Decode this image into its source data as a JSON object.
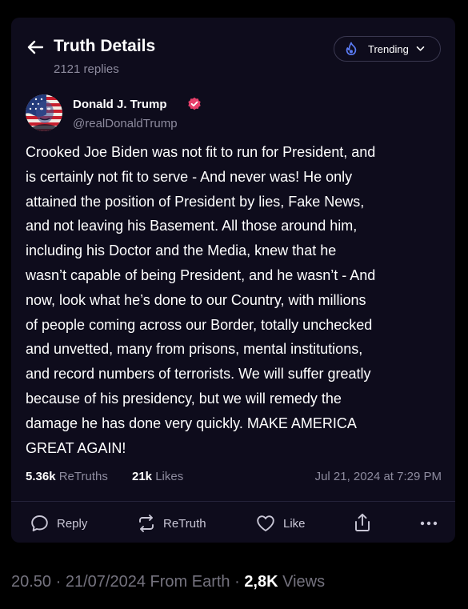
{
  "header": {
    "title": "Truth Details",
    "replies": "2121 replies",
    "trending_label": "Trending"
  },
  "post": {
    "author_name": "Donald J. Trump",
    "handle": "@realDonaldTrump",
    "body_lines": [
      "Crooked Joe Biden was not fit to run for President, and",
      "is certainly not fit to serve - And never was! He only",
      "attained the position of President by lies, Fake News,",
      "and not leaving his Basement. All those around him,",
      "including his Doctor and the Media, knew that he",
      "wasn’t capable of being President, and he wasn’t - And",
      "now, look what he’s done to our Country, with millions",
      "of people coming across our Border, totally unchecked",
      "and unvetted, many from prisons, mental institutions,",
      "and record numbers of terrorists. We will suffer greatly",
      "because of his presidency, but we will remedy the",
      "damage he has done very quickly. MAKE AMERICA",
      "GREAT AGAIN!"
    ],
    "retruths_count": "5.36k",
    "retruths_label": "ReTruths",
    "likes_count": "21k",
    "likes_label": "Likes",
    "timestamp": "Jul 21, 2024 at 7:29 PM"
  },
  "actions": {
    "reply_label": "Reply",
    "retruth_label": "ReTruth",
    "like_label": "Like"
  },
  "footer": {
    "time": "20.50",
    "sep1": " · ",
    "date": "21/07/2024",
    "source": " From Earth",
    "sep2": " · ",
    "views_count": "2,8K",
    "views_label": " Views"
  },
  "colors": {
    "page_background": "#000000",
    "card_background": "#0e0c1c",
    "secondary_text": "#8d8b9e",
    "verified_badge": "#e8406b",
    "trending_icon": "#5b7cf5",
    "divider": "#24223a"
  },
  "icons": {
    "back": "arrow-left-icon",
    "trending": "flame-icon",
    "dropdown": "chevron-down-icon",
    "verified": "verified-badge-icon",
    "reply": "speech-bubble-icon",
    "retruth": "repost-arrows-icon",
    "like": "heart-icon",
    "share": "share-upload-icon",
    "more": "more-dots-icon"
  }
}
